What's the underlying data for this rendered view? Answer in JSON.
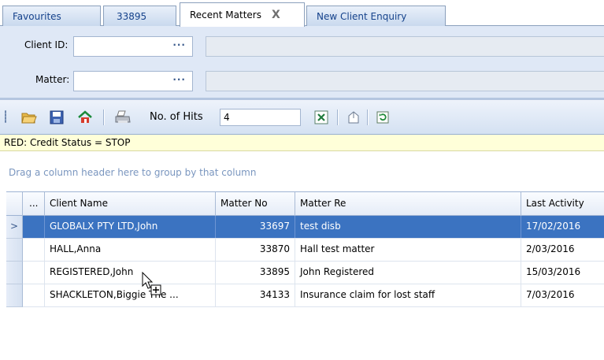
{
  "tabs": [
    {
      "label": "Favourites",
      "active": false
    },
    {
      "label": "33895",
      "active": false
    },
    {
      "label": "Recent Matters",
      "active": true,
      "close": "X"
    },
    {
      "label": "New Client Enquiry",
      "active": false
    }
  ],
  "lookup": {
    "client_label": "Client ID:",
    "matter_label": "Matter:",
    "client_value": "",
    "matter_value": "",
    "ellipsis": "···"
  },
  "toolbar": {
    "hits_label": "No. of Hits",
    "hits_value": "4",
    "icons": [
      "open-folder-icon",
      "save-icon",
      "home-icon",
      "print-icon",
      "excel-export-icon",
      "share-icon",
      "refresh-icon"
    ]
  },
  "status": {
    "text": "RED: Credit Status = STOP",
    "color": "#ffffd9"
  },
  "grid": {
    "group_hint": "Drag a column header here to group by that column",
    "columns": {
      "ellipsis": "...",
      "client_name": "Client Name",
      "matter_no": "Matter No",
      "matter_re": "Matter Re",
      "last_activity": "Last Activity"
    },
    "rows": [
      {
        "indicator": ">",
        "client_name": "GLOBALX PTY LTD,John",
        "matter_no": "33697",
        "matter_re": "test disb",
        "last_activity": "17/02/2016",
        "selected": true
      },
      {
        "indicator": "",
        "client_name": "HALL,Anna",
        "matter_no": "33870",
        "matter_re": "Hall test matter",
        "last_activity": "2/03/2016",
        "selected": false
      },
      {
        "indicator": "",
        "client_name": "REGISTERED,John",
        "matter_no": "33895",
        "matter_re": "John Registered",
        "last_activity": "15/03/2016",
        "selected": false
      },
      {
        "indicator": "",
        "client_name": "SHACKLETON,Biggie The ...",
        "matter_no": "34133",
        "matter_re": "Insurance claim for lost staff",
        "last_activity": "7/03/2016",
        "selected": false
      }
    ]
  },
  "colors": {
    "selected_row": "#3b73c1",
    "panel": "#dfe8f6",
    "tab_text": "#15428b"
  }
}
